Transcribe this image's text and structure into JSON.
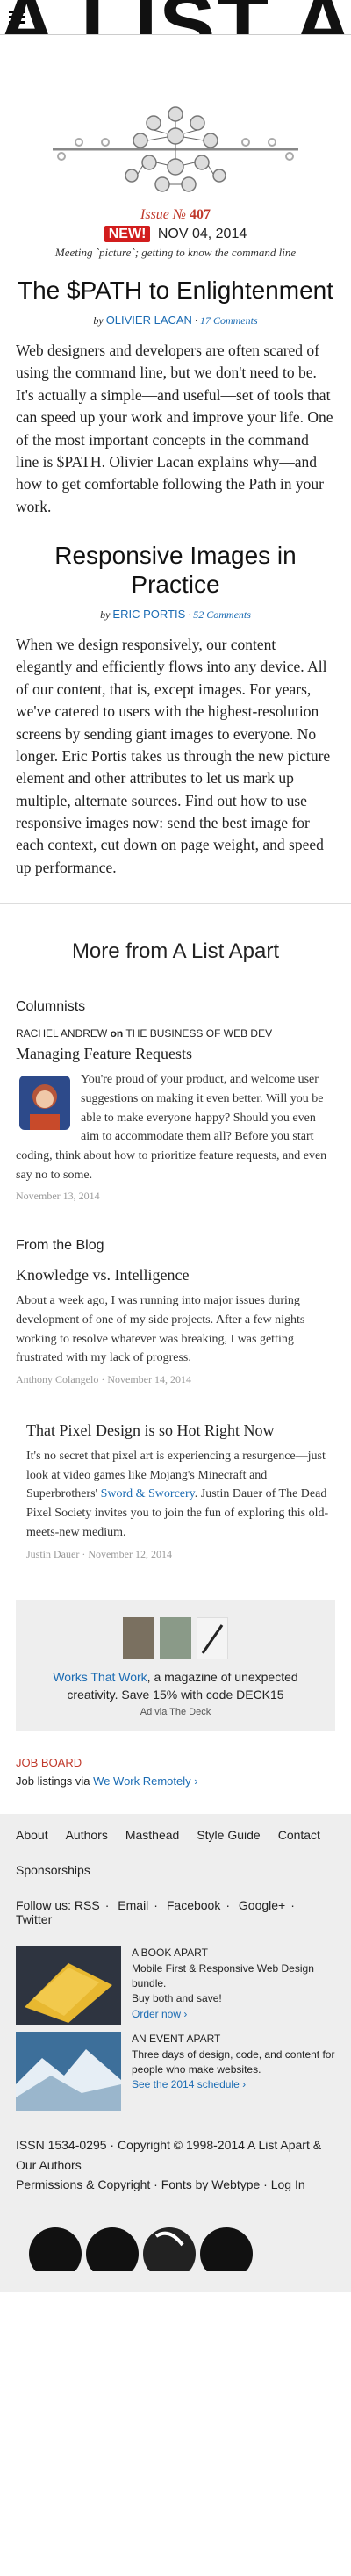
{
  "header": {
    "brand": "A LIST A"
  },
  "issue": {
    "label": "Issue №",
    "number": "407",
    "badge": "NEW!",
    "date": "NOV 04, 2014",
    "tagline": "Meeting `picture`; getting to know the command line"
  },
  "article1": {
    "title": "The $PATH to Enlightenment",
    "by": "by",
    "author": "OLIVIER LACAN",
    "comments": "17 Comments",
    "body": "Web designers and developers are often scared of using the command line, but we don't need to be. It's actually a simple—and useful—set of tools that can speed up your work and improve your life. One of the most important concepts in the command line is $PATH. Olivier Lacan explains why—and how to get comfortable following the Path in your work."
  },
  "article2": {
    "title": "Responsive Images in Practice",
    "by": "by",
    "author": "ERIC PORTIS",
    "comments": "52 Comments",
    "body": "When we design responsively, our content elegantly and efficiently flows into any device. All of our content, that is, except images. For years, we've catered to users with the highest-resolution screens by sending giant images to everyone. No longer. Eric Portis takes us through the new picture element and other attributes to let us mark up multiple, alternate sources. Find out how to use responsive images now: send the best image for each context, cut down on page weight, and speed up performance."
  },
  "more": {
    "heading": "More from A List Apart"
  },
  "columnists": {
    "label": "Columnists",
    "author": "RACHEL ANDREW",
    "on": "on",
    "column": "THE BUSINESS OF WEB DEV",
    "title": "Managing Feature Requests",
    "body": "You're proud of your product, and welcome user suggestions on making it even better. Will you be able to make everyone happy? Should you even aim to accommodate them all? Before you start coding, think about how to prioritize feature requests, and even say no to some.",
    "date": "November 13, 2014"
  },
  "blog": {
    "label": "From the Blog",
    "post1": {
      "title": "Knowledge vs. Intelligence",
      "body": "About a week ago, I was running into major issues during development of one of my side projects. After a few nights working to resolve whatever was breaking, I was getting frustrated with my lack of progress.",
      "meta": "Anthony Colangelo · November 14, 2014"
    },
    "post2": {
      "title": "That Pixel Design is so Hot Right Now",
      "body_a": "It's no secret that pixel art is experiencing a resurgence—just look at video games like Mojang's Minecraft and Superbrothers' ",
      "link": "Sword & Sworcery",
      "body_b": ". Justin Dauer of The Dead Pixel Society invites you to join the fun of exploring this old-meets-new medium.",
      "meta": "Justin Dauer · November 12, 2014"
    }
  },
  "ad": {
    "link": "Works That Work",
    "text": ", a magazine of unexpected creativity. Save 15% with code DECK15",
    "via": "Ad via The Deck"
  },
  "jobboard": {
    "label": "JOB BOARD",
    "text": "Job listings via ",
    "link": "We Work Remotely",
    "arrow": "›"
  },
  "footer": {
    "nav": [
      "About",
      "Authors",
      "Masthead",
      "Style Guide",
      "Contact",
      "Sponsorships"
    ],
    "follow_label": "Follow us:",
    "follow": [
      "RSS",
      "Email",
      "Facebook",
      "Google+",
      "Twitter"
    ],
    "book": {
      "heading": "A BOOK APART",
      "line1": "Mobile First & Responsive Web Design bundle.",
      "line2": "Buy both and save!",
      "link": "Order now ›"
    },
    "event": {
      "heading": "AN EVENT APART",
      "line1": "Three days of design, code, and content for people who make websites.",
      "link": "See the 2014 schedule ›"
    },
    "legal1": "ISSN 1534-0295 · Copyright © 1998-2014 A List Apart & Our Authors",
    "legal2": "Permissions & Copyright · Fonts by Webtype · Log In"
  }
}
